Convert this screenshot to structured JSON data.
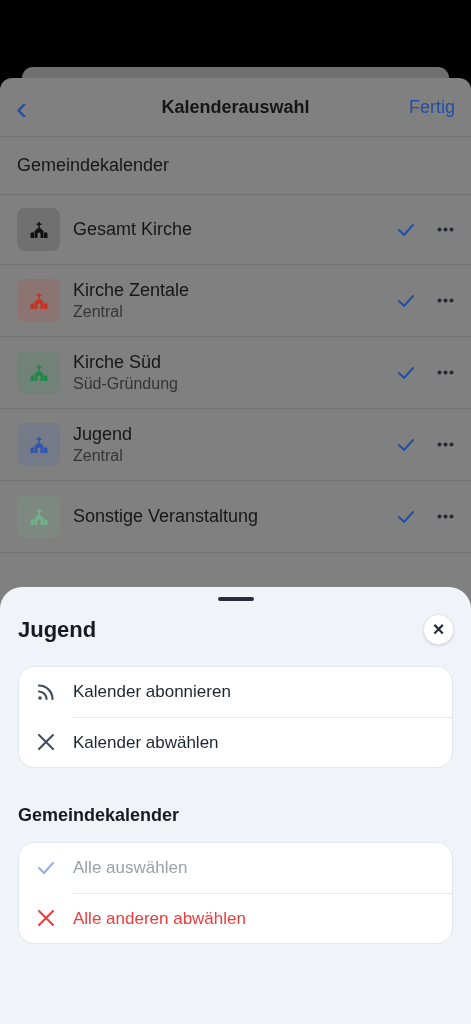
{
  "screen": {
    "back_label": "‹",
    "title": "Kalenderauswahl",
    "done": "Fertig"
  },
  "section": "Gemeindekalender",
  "calendars": [
    {
      "name": "Gesamt Kirche",
      "color": "#111111",
      "checked": true
    },
    {
      "name": "Kirche Zentale",
      "subtitle": "Zentral",
      "color": "#c8321e",
      "checked": true
    },
    {
      "name": "Kirche Süd",
      "subtitle": "Süd-Gründung",
      "color": "#1d8a4a",
      "checked": true
    },
    {
      "name": "Jugend",
      "subtitle": "Zentral",
      "color": "#2f55b0",
      "checked": true
    },
    {
      "name": "Sonstige Veranstaltung",
      "color": "#6fb28a",
      "checked": true
    }
  ],
  "sheet": {
    "title": "Jugend",
    "close": "×",
    "actions": [
      {
        "kind": "rss",
        "label": "Kalender abonnieren",
        "disabled": false,
        "destructive": false
      },
      {
        "kind": "cross",
        "label": "Kalender abwählen",
        "disabled": false,
        "destructive": false
      }
    ],
    "group_title": "Gemeindekalender",
    "group_actions": [
      {
        "kind": "check",
        "label": "Alle auswählen",
        "disabled": true,
        "destructive": false
      },
      {
        "kind": "cross",
        "label": "Alle anderen abwählen",
        "disabled": false,
        "destructive": true
      }
    ]
  }
}
